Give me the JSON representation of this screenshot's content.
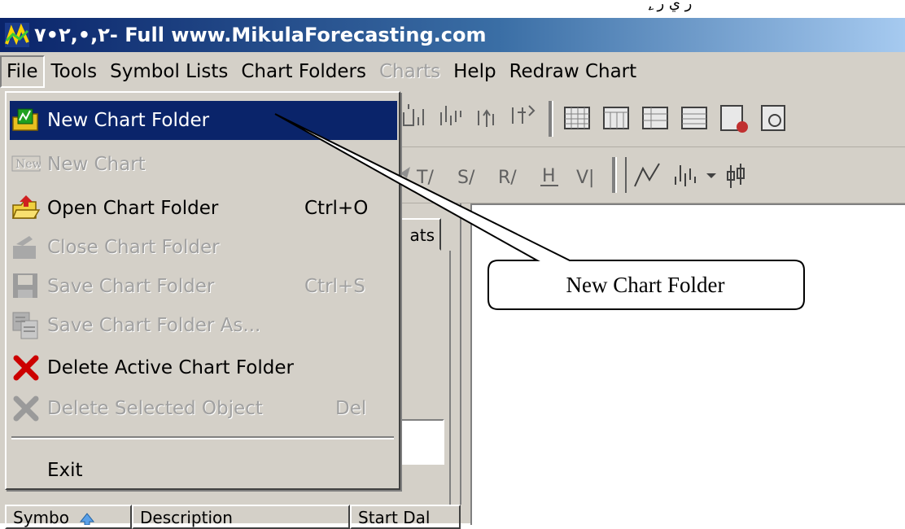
{
  "top_strip": {
    "stray_text": "ِ, ر ي ر"
  },
  "titlebar": {
    "title": "٢,•,٢•٧- Full www.MikulaForecasting.com"
  },
  "menubar": {
    "items": [
      {
        "label": "File",
        "state": "active"
      },
      {
        "label": "Tools",
        "state": "normal"
      },
      {
        "label": "Symbol Lists",
        "state": "normal"
      },
      {
        "label": "Chart Folders",
        "state": "normal"
      },
      {
        "label": "Charts",
        "state": "disabled"
      },
      {
        "label": "Help",
        "state": "normal"
      },
      {
        "label": "Redraw Chart",
        "state": "normal"
      }
    ]
  },
  "file_menu": {
    "items": [
      {
        "label": "New Chart Folder",
        "shortcut": "",
        "icon": "new-chart-folder-icon",
        "state": "highlighted"
      },
      {
        "label": "New Chart",
        "shortcut": "",
        "icon": "new-icon",
        "state": "disabled",
        "icon_text": "New"
      },
      {
        "label": "Open Chart Folder",
        "shortcut": "Ctrl+O",
        "icon": "open-folder-icon",
        "state": "normal"
      },
      {
        "label": "Close Chart Folder",
        "shortcut": "",
        "icon": "close-folder-icon",
        "state": "disabled"
      },
      {
        "label": "Save Chart Folder",
        "shortcut": "Ctrl+S",
        "icon": "save-icon",
        "state": "disabled"
      },
      {
        "label": "Save Chart Folder As...",
        "shortcut": "",
        "icon": "save-as-icon",
        "state": "disabled"
      },
      {
        "label": "Delete Active Chart Folder",
        "shortcut": "",
        "icon": "delete-icon",
        "state": "normal"
      },
      {
        "label": "Delete Selected Object",
        "shortcut": "Del",
        "icon": "delete-icon",
        "state": "disabled"
      },
      {
        "label": "Exit",
        "shortcut": "",
        "icon": "",
        "state": "normal"
      }
    ]
  },
  "toolbar2": {
    "t_label": "T/",
    "s_label": "S/",
    "r_label": "R/",
    "h_label": "H",
    "v_label": "V|"
  },
  "side_panel": {
    "tab_label": "ats"
  },
  "grid_header": {
    "symbol": "Symbo",
    "description": "Description",
    "start_date": "Start Dal"
  },
  "callout": {
    "text": "New Chart Folder"
  },
  "colors": {
    "highlight": "#0a246a",
    "face": "#d4d0c8",
    "delete_red": "#cc0000"
  }
}
